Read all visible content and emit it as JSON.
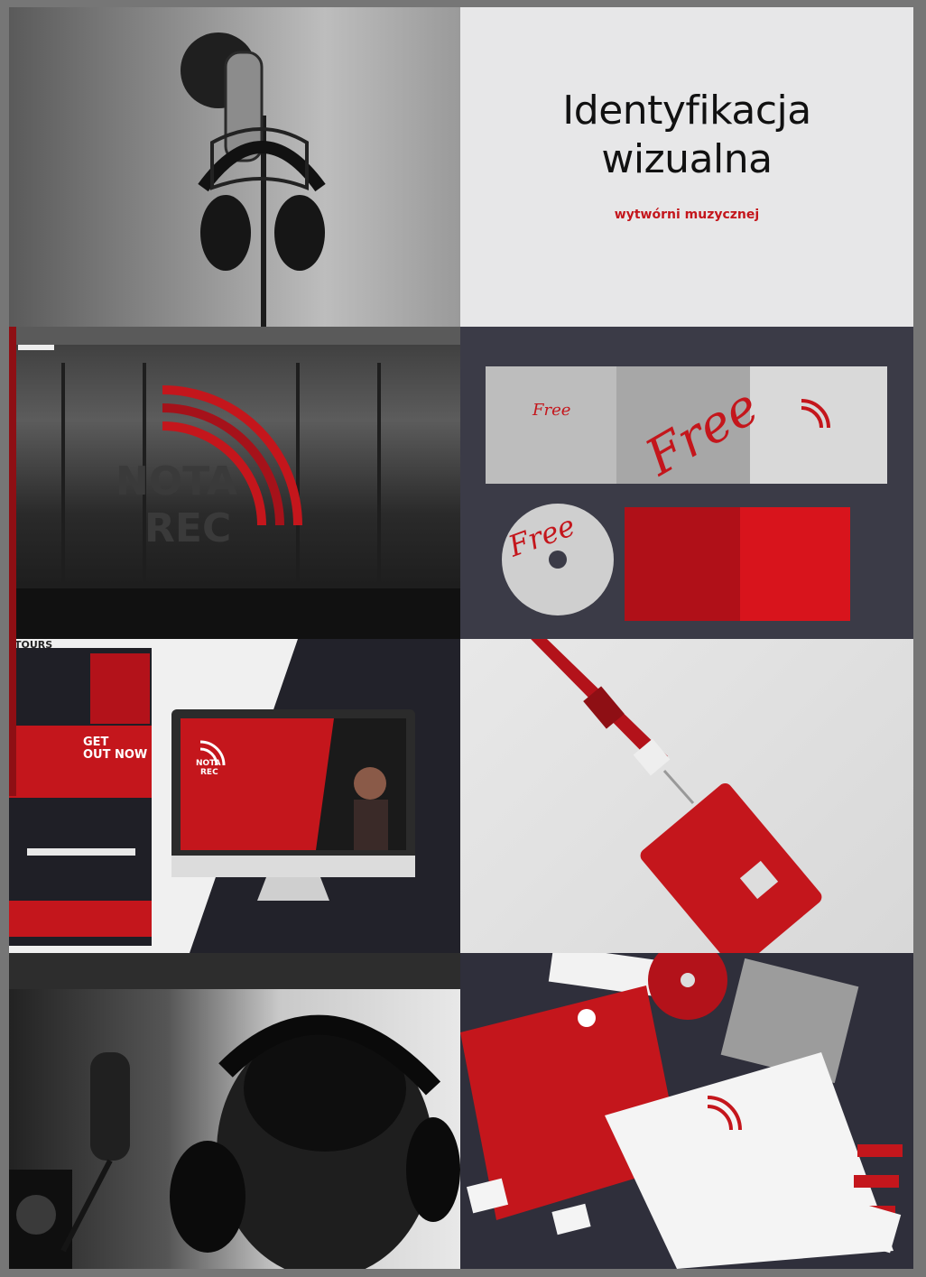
{
  "title": {
    "line1": "Identyfikacja",
    "line2": "wizualna",
    "subtitle": "wytwórni muzycznej"
  },
  "office_logo": {
    "line1": "NOTA",
    "line2": "REC"
  },
  "cd_package": {
    "album_word": "Free"
  },
  "web_mockup": {
    "tours_label": "TOURS",
    "promo_line1": "GET",
    "promo_line2": "OUT NOW",
    "logo_line1": "NOTA",
    "logo_line2": "REC"
  },
  "colors": {
    "brand_red": "#c4161c",
    "dark_navy": "#2f2f3b",
    "light_gray": "#e6e6e6"
  }
}
